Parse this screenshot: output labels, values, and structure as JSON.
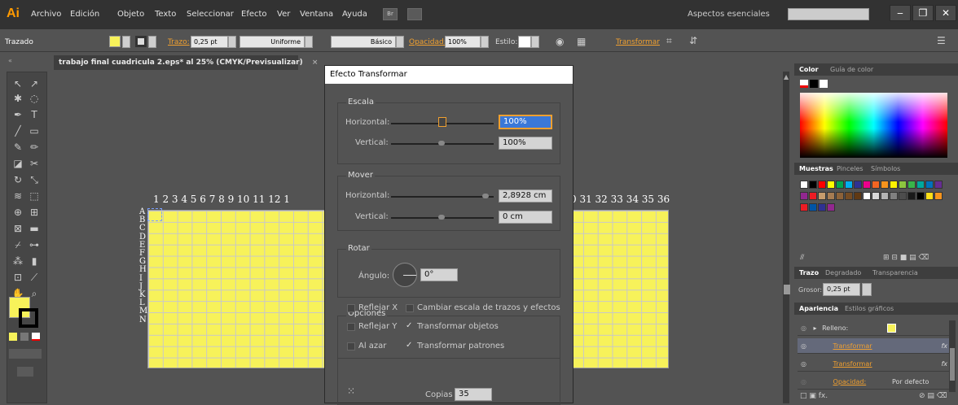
{
  "app": {
    "logo": "Ai"
  },
  "menu": [
    "Archivo",
    "Edición",
    "Objeto",
    "Texto",
    "Seleccionar",
    "Efecto",
    "Ver",
    "Ventana",
    "Ayuda"
  ],
  "menu_extra": {
    "br": "Br"
  },
  "workspace": "Aspectos esenciales",
  "window_buttons": {
    "minimize": "‒",
    "restore": "❐",
    "close": "✕"
  },
  "control_bar": {
    "object_type": "Trazado",
    "stroke_label": "Trazo:",
    "stroke_value": "0,25 pt",
    "profile": "Uniforme",
    "brush": "Básico",
    "opacity_label": "Opacidad:",
    "opacity_value": "100%",
    "style_label": "Estilo:",
    "transform_label": "Transformar",
    "colors": {
      "fill": "#f7f25a",
      "link": "#f0a030"
    }
  },
  "document": {
    "tab_title": "trabajo final cuadricula 2.eps* al 25% (CMYK/Previsualizar)",
    "tab_close": "×",
    "col_numbers_left": "1  2  3  4  5  6  7  8  9  10 11 12 1",
    "col_numbers_right": "0 31 32 33 34 35 36",
    "row_letters": [
      "A",
      "B",
      "C",
      "D",
      "E",
      "F",
      "G",
      "H",
      "I",
      "J",
      "K",
      "L",
      "M",
      "N"
    ]
  },
  "dialog": {
    "title": "Efecto Transformar",
    "scale": {
      "title": "Escala",
      "horizontal_label": "Horizontal:",
      "horizontal_value": "100%",
      "vertical_label": "Vertical:",
      "vertical_value": "100%"
    },
    "move": {
      "title": "Mover",
      "horizontal_label": "Horizontal:",
      "horizontal_value": "2,8928 cm",
      "vertical_label": "Vertical:",
      "vertical_value": "0 cm"
    },
    "rotate": {
      "title": "Rotar",
      "angle_label": "Ángulo:",
      "angle_value": "0°"
    },
    "options": {
      "title": "Opciones",
      "reflect_x": "Reflejar X",
      "scale_strokes": "Cambiar escala de trazos y efectos",
      "reflect_y": "Reflejar Y",
      "transform_objects": "Transformar objetos",
      "random": "Al azar",
      "transform_patterns": "Transformar patrones",
      "check": "✓"
    },
    "copies_label": "Copias",
    "copies_value": "35"
  },
  "panels": {
    "color_tab": "Color",
    "color_guide_tab": "Guía de color",
    "swatches_tab": "Muestras",
    "brushes_tab": "Pinceles",
    "symbols_tab": "Símbolos",
    "stroke_tab": "Trazo",
    "gradient_tab": "Degradado",
    "transparency_tab": "Transparencia",
    "weight_label": "Grosor:",
    "weight_value": "0,25 pt",
    "appearance_tab": "Apariencia",
    "graphic_styles_tab": "Estilos gráficos",
    "appearance_rows": {
      "fill": "Relleno:",
      "transform1": "Transformar",
      "transform2": "Transformar",
      "opacity": "Opacidad:",
      "opacity_value": "Por defecto",
      "fx": "fx"
    },
    "swatch_colors": [
      "#ffffff",
      "#000000",
      "#ff0000",
      "#ffff00",
      "#00a651",
      "#00aeef",
      "#2e3192",
      "#ec008c",
      "#f26522",
      "#f7941d",
      "#fff200",
      "#8dc63f",
      "#39b54a",
      "#00a99d",
      "#0072bc",
      "#662d91",
      "#92278f",
      "#ed1c24",
      "#c69c6d",
      "#a67c52",
      "#8c6239",
      "#754c24",
      "#603913",
      "#ffffff",
      "#d9d9d9",
      "#b3b3b3",
      "#808080",
      "#4d4d4d",
      "#1a1a1a",
      "#000000",
      "#ffde17",
      "#f7941d",
      "#ed1c24",
      "#0054a6",
      "#2e3192",
      "#92278f"
    ]
  }
}
